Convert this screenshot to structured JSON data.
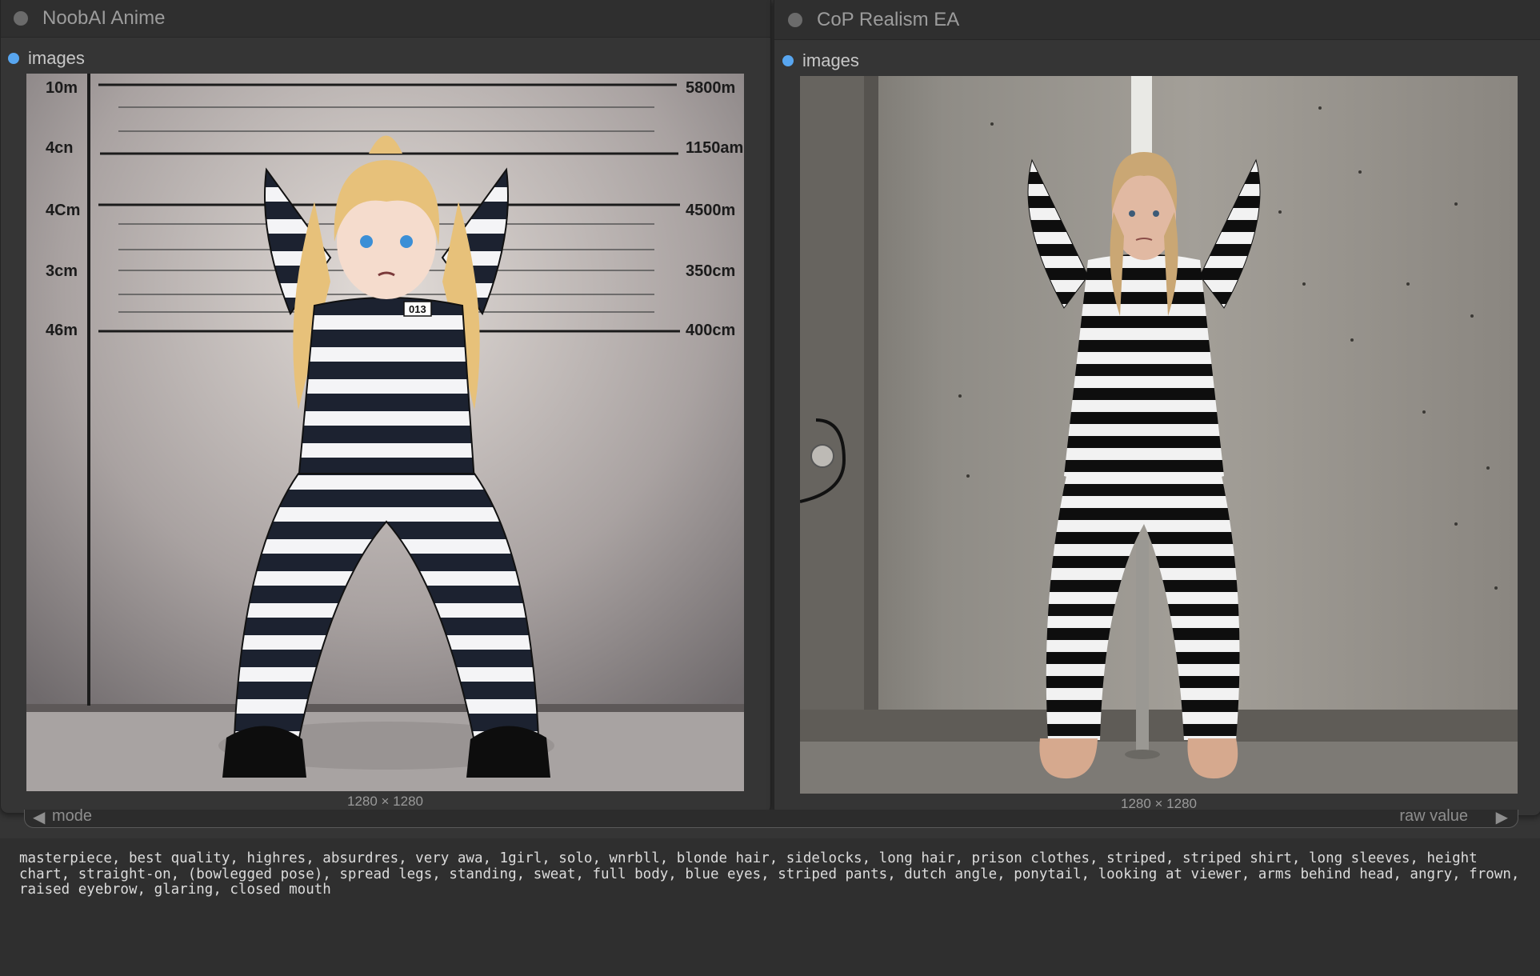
{
  "panels": [
    {
      "title": "NoobAI Anime",
      "slot_label": "images",
      "image_dims": "1280 × 1280"
    },
    {
      "title": "CoP Realism EA",
      "slot_label": "images",
      "image_dims": "1280 × 1280"
    }
  ],
  "chart_labels": {
    "left": [
      "10m",
      "4cn",
      "4Cm",
      "3cm",
      "46m"
    ],
    "right": [
      "5800m",
      "1150am",
      "4500m",
      "350cm",
      "400cm"
    ]
  },
  "widget": {
    "left_label": "mode",
    "right_label": "raw value"
  },
  "prompt": "masterpiece, best quality, highres, absurdres, very awa, 1girl, solo, wnrbll, blonde hair, sidelocks, long hair, prison clothes, striped, striped shirt, long sleeves, height chart, straight-on, (bowlegged pose), spread legs, standing, sweat, full body, blue eyes, striped pants, dutch angle, ponytail, looking at viewer, arms behind head, angry, frown, raised eyebrow, glaring, closed mouth",
  "colors": {
    "accent": "#58a6f0",
    "node_bg": "#353535"
  }
}
